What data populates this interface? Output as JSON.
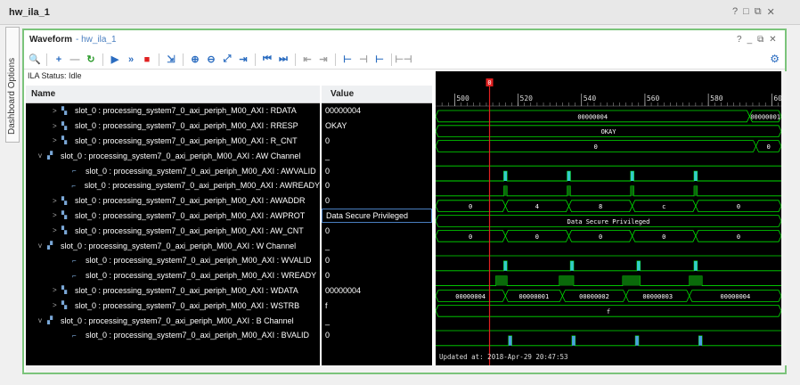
{
  "window": {
    "title": "hw_ila_1",
    "buttons": [
      "?",
      "□",
      "⧉",
      "✕"
    ]
  },
  "side_tab": {
    "label": "Dashboard Options"
  },
  "panel": {
    "title": "Waveform",
    "subtitle": "- hw_ila_1",
    "buttons": [
      "?",
      "_",
      "⧉",
      "✕"
    ]
  },
  "toolbar": {
    "icons": [
      {
        "name": "search-icon",
        "glyph": "🔍",
        "color": "blue"
      },
      {
        "name": "add-icon",
        "glyph": "+",
        "color": "blue"
      },
      {
        "name": "remove-icon",
        "glyph": "—",
        "color": "gray"
      },
      {
        "name": "refresh-icon",
        "glyph": "↻",
        "color": "green"
      },
      {
        "name": "run-icon",
        "glyph": "▶",
        "color": "blue"
      },
      {
        "name": "run-immediate-icon",
        "glyph": "»",
        "color": "blue"
      },
      {
        "name": "stop-icon",
        "glyph": "■",
        "color": "red"
      },
      {
        "name": "export-icon",
        "glyph": "⇲",
        "color": "blue"
      },
      {
        "name": "zoom-in-icon",
        "glyph": "⊕",
        "color": "blue"
      },
      {
        "name": "zoom-out-icon",
        "glyph": "⊖",
        "color": "blue"
      },
      {
        "name": "zoom-fit-icon",
        "glyph": "⤢",
        "color": "blue"
      },
      {
        "name": "go-to-cursor-icon",
        "glyph": "⇥",
        "color": "blue"
      },
      {
        "name": "go-to-start-icon",
        "glyph": "⏮",
        "color": "blue"
      },
      {
        "name": "go-to-end-icon",
        "glyph": "⏭",
        "color": "blue"
      },
      {
        "name": "prev-transition-icon",
        "glyph": "⇤",
        "color": "gray"
      },
      {
        "name": "next-transition-icon",
        "glyph": "⇥",
        "color": "gray"
      },
      {
        "name": "add-marker-icon",
        "glyph": "⊢",
        "color": "blue"
      },
      {
        "name": "prev-marker-icon",
        "glyph": "⊣",
        "color": "gray"
      },
      {
        "name": "next-marker-icon",
        "glyph": "⊢",
        "color": "blue"
      },
      {
        "name": "swap-cursors-icon",
        "glyph": "⊢⊣",
        "color": "gray"
      }
    ]
  },
  "ila_status": "ILA Status:  Idle",
  "columns": {
    "name": "Name",
    "value": "Value"
  },
  "signals": [
    {
      "indent": 1,
      "expand": ">",
      "icon": "bus",
      "name": "slot_0 : processing_system7_0_axi_periph_M00_AXI : RDATA",
      "value": "00000004"
    },
    {
      "indent": 1,
      "expand": ">",
      "icon": "bus",
      "name": "slot_0 : processing_system7_0_axi_periph_M00_AXI : RRESP",
      "value": "OKAY"
    },
    {
      "indent": 1,
      "expand": ">",
      "icon": "bus",
      "name": "slot_0 : processing_system7_0_axi_periph_M00_AXI : R_CNT",
      "value": "0"
    },
    {
      "indent": 0,
      "expand": "v",
      "icon": "group",
      "name": "slot_0 : processing_system7_0_axi_periph_M00_AXI : AW Channel",
      "value": "_"
    },
    {
      "indent": 2,
      "expand": "",
      "icon": "wire",
      "name": "slot_0 : processing_system7_0_axi_periph_M00_AXI : AWVALID",
      "value": "0"
    },
    {
      "indent": 2,
      "expand": "",
      "icon": "wire",
      "name": "slot_0 : processing_system7_0_axi_periph_M00_AXI : AWREADY",
      "value": "0"
    },
    {
      "indent": 1,
      "expand": ">",
      "icon": "bus",
      "name": "slot_0 : processing_system7_0_axi_periph_M00_AXI : AWADDR",
      "value": "0"
    },
    {
      "indent": 1,
      "expand": ">",
      "icon": "bus",
      "name": "slot_0 : processing_system7_0_axi_periph_M00_AXI : AWPROT",
      "value": "Data Secure Privileged"
    },
    {
      "indent": 1,
      "expand": ">",
      "icon": "bus",
      "name": "slot_0 : processing_system7_0_axi_periph_M00_AXI : AW_CNT",
      "value": "0"
    },
    {
      "indent": 0,
      "expand": "v",
      "icon": "group",
      "name": "slot_0 : processing_system7_0_axi_periph_M00_AXI : W Channel",
      "value": "_"
    },
    {
      "indent": 2,
      "expand": "",
      "icon": "wire",
      "name": "slot_0 : processing_system7_0_axi_periph_M00_AXI : WVALID",
      "value": "0"
    },
    {
      "indent": 2,
      "expand": "",
      "icon": "wire",
      "name": "slot_0 : processing_system7_0_axi_periph_M00_AXI : WREADY",
      "value": "0"
    },
    {
      "indent": 1,
      "expand": ">",
      "icon": "bus",
      "name": "slot_0 : processing_system7_0_axi_periph_M00_AXI : WDATA",
      "value": "00000004"
    },
    {
      "indent": 1,
      "expand": ">",
      "icon": "bus",
      "name": "slot_0 : processing_system7_0_axi_periph_M00_AXI : WSTRB",
      "value": "f"
    },
    {
      "indent": 0,
      "expand": "v",
      "icon": "group",
      "name": "slot_0 : processing_system7_0_axi_periph_M00_AXI : B Channel",
      "value": "_"
    },
    {
      "indent": 2,
      "expand": "",
      "icon": "wire",
      "name": "slot_0 : processing_system7_0_axi_periph_M00_AXI : BVALID",
      "value": "0"
    }
  ],
  "selected_value_row": 7,
  "waveform": {
    "timeline_labels": [
      "500",
      "520",
      "540",
      "560",
      "580",
      "600"
    ],
    "cursor_label": "0",
    "cursor_time": 511,
    "time_range": [
      494,
      603
    ],
    "updated": "Updated at: 2018-Apr-29 20:47:53",
    "bus_values": {
      "RDATA": [
        "00000004",
        "00000001"
      ],
      "RRESP": [
        "OKAY"
      ],
      "R_CNT": [
        "0",
        "0"
      ],
      "AWADDR": [
        "0",
        "4",
        "8",
        "c",
        "0"
      ],
      "AWPROT": [
        "Data Secure Privileged"
      ],
      "AW_CNT": [
        "0",
        "0",
        "0",
        "0",
        "0"
      ],
      "WDATA": [
        "00000004",
        "00000001",
        "00000002",
        "00000003",
        "00000004"
      ],
      "WSTRB": [
        "f"
      ]
    },
    "colors": {
      "wave": "#00e000",
      "bus_text": "#ffffff",
      "cursor": "#e02020",
      "pulse": "#33cccc",
      "bg": "#000000"
    }
  }
}
